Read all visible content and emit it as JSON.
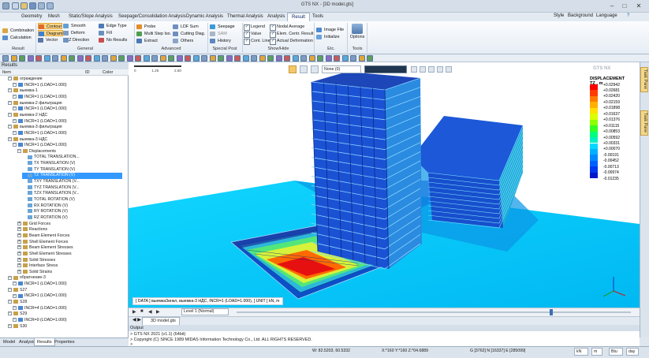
{
  "window": {
    "title": "GTS NX - [3D model.gts]",
    "controls": [
      "–",
      "□",
      "✕"
    ]
  },
  "menu": {
    "tabs": [
      "Geometry",
      "Mesh",
      "Static/Slope Analysis",
      "Seepage/Consolidation Analysis",
      "Dynamic Analysis",
      "Thermal Analysis",
      "Analysis",
      "Result",
      "Tools"
    ],
    "right": {
      "style": "Style",
      "background": "Background",
      "language": "Language"
    }
  },
  "ribbon": {
    "result": {
      "combination": "Combination",
      "calculation": "Calculation",
      "label": "Result"
    },
    "general": {
      "contour": "Contour",
      "diagram": "Diagram",
      "vector": "Vector",
      "smooth": "Smooth",
      "deform": "Deform",
      "xyz_direction": "XYZ Direction",
      "edge_type": "Edge Type",
      "fill": "Fill",
      "no_results": "No Results",
      "label": "General"
    },
    "advanced": {
      "probe": "Probe",
      "multi_step": "Multi Step Iso.",
      "extract": "Extract",
      "ldf_sum": "LDF Sum",
      "cutting_diag": "Cutting Diag.",
      "others": "Others",
      "label": "Advanced"
    },
    "special_post": {
      "seepage": "Seepage",
      "sam": "SAM",
      "history": "History",
      "label": "Special Post"
    },
    "show_hide": {
      "legend": "Legend",
      "value": "Value",
      "cont_line": "Cont. Line",
      "nodal_average": "Nodal Average",
      "elem_centr_result": "Elem. Centr. Result",
      "actual_deformation": "Actual Deformation",
      "label": "Show/Hide"
    },
    "etc": {
      "image_file": "Image File",
      "initialize": "Initialize",
      "label": "Etc."
    },
    "tools": {
      "options": "Options",
      "label": "Tools"
    }
  },
  "results_panel": {
    "title": "Results",
    "columns": {
      "item": "Item",
      "id": "ID",
      "color": "Color"
    },
    "tree": [
      {
        "label": "ограждение",
        "indent": 1,
        "icon": "folder"
      },
      {
        "label": "INCR=1 (LOAD=1.000)",
        "indent": 2,
        "icon": "step"
      },
      {
        "label": "выемка-1",
        "indent": 1,
        "icon": "folder"
      },
      {
        "label": "INCR=1 (LOAD=1.000)",
        "indent": 2,
        "icon": "step"
      },
      {
        "label": "выемка-2 фильтрация",
        "indent": 1,
        "icon": "folder"
      },
      {
        "label": "INCR=1 (LOAD=1.000)",
        "indent": 2,
        "icon": "step"
      },
      {
        "label": "выемка-2 НДС",
        "indent": 1,
        "icon": "folder"
      },
      {
        "label": "INCR=1 (LOAD=1.000)",
        "indent": 2,
        "icon": "step"
      },
      {
        "label": "выемка-3 фильтрация",
        "indent": 1,
        "icon": "folder"
      },
      {
        "label": "INCR=1 (LOAD=1.000)",
        "indent": 2,
        "icon": "step"
      },
      {
        "label": "выемка-3 НДС",
        "indent": 1,
        "icon": "folder"
      },
      {
        "label": "INCR=1 (LOAD=1.000)",
        "indent": 2,
        "icon": "step"
      },
      {
        "label": "Displacements",
        "indent": 3,
        "icon": "folder"
      },
      {
        "label": "TOTAL TRANSLATION...",
        "indent": 4,
        "icon": "result"
      },
      {
        "label": "TX TRANSLATION (V)",
        "indent": 4,
        "icon": "result"
      },
      {
        "label": "TY TRANSLATION (V)",
        "indent": 4,
        "icon": "result"
      },
      {
        "label": "TZ TRANSLATION (V)",
        "indent": 4,
        "icon": "result",
        "selected": true
      },
      {
        "label": "TXY TRANSLATION (V...",
        "indent": 4,
        "icon": "result"
      },
      {
        "label": "TYZ TRANSLATION (V...",
        "indent": 4,
        "icon": "result"
      },
      {
        "label": "TZX TRANSLATION (V...",
        "indent": 4,
        "icon": "result"
      },
      {
        "label": "TOTAL ROTATION (V)",
        "indent": 4,
        "icon": "result"
      },
      {
        "label": "RX ROTATION (V)",
        "indent": 4,
        "icon": "result"
      },
      {
        "label": "RY ROTATION (V)",
        "indent": 4,
        "icon": "result"
      },
      {
        "label": "RZ ROTATION (V)",
        "indent": 4,
        "icon": "result"
      },
      {
        "label": "Grid Forces",
        "indent": 3,
        "icon": "folder"
      },
      {
        "label": "Reactions",
        "indent": 3,
        "icon": "folder"
      },
      {
        "label": "Beam Element Forces",
        "indent": 3,
        "icon": "folder"
      },
      {
        "label": "Shell Element Forces",
        "indent": 3,
        "icon": "folder"
      },
      {
        "label": "Beam Element Stresses",
        "indent": 3,
        "icon": "folder"
      },
      {
        "label": "Shell Element Stresses",
        "indent": 3,
        "icon": "folder"
      },
      {
        "label": "Solid Stresses",
        "indent": 3,
        "icon": "folder"
      },
      {
        "label": "Interface Stress",
        "indent": 3,
        "icon": "folder"
      },
      {
        "label": "Solid Strains",
        "indent": 3,
        "icon": "folder"
      },
      {
        "label": "обратнение-3",
        "indent": 1,
        "icon": "folder"
      },
      {
        "label": "INCR=1 (LOAD=1.000)",
        "indent": 2,
        "icon": "step"
      },
      {
        "label": "S27",
        "indent": 1,
        "icon": "folder"
      },
      {
        "label": "INCR=1 (LOAD=1.000)",
        "indent": 2,
        "icon": "step"
      },
      {
        "label": "S28",
        "indent": 1,
        "icon": "folder"
      },
      {
        "label": "INCR=4 (LOAD=1.000)",
        "indent": 2,
        "icon": "step"
      },
      {
        "label": "S29",
        "indent": 1,
        "icon": "folder"
      },
      {
        "label": "INCR=9 (LOAD=1.000)",
        "indent": 2,
        "icon": "step"
      },
      {
        "label": "S30",
        "indent": 1,
        "icon": "folder"
      }
    ],
    "bottom_tabs": [
      "Model",
      "Analysis",
      "Results",
      "Properties"
    ]
  },
  "viewport": {
    "view_dropdown": "None (0)",
    "legend": {
      "title": "DISPLACEMENT",
      "subtitle": "TZ , m",
      "values": [
        "+0.02942",
        "+0.02681",
        "+0.02420",
        "+0.02159",
        "+0.01898",
        "+0.01637",
        "+0.01376",
        "+0.01115",
        "+0.00853",
        "+0.00592",
        "+0.00331",
        "+0.00070",
        "-0.00191",
        "-0.00452",
        "-0.00713",
        "-0.00974",
        "-0.01235"
      ],
      "colors": [
        "#ff0000",
        "#ff3b00",
        "#ff7a00",
        "#ffb000",
        "#ffe000",
        "#d9ff00",
        "#8cff00",
        "#35ff22",
        "#00ff7a",
        "#00f0c0",
        "#00d8ff",
        "#00b0ff",
        "#0088ff",
        "#0060ff",
        "#0038f0",
        "#0018c8"
      ]
    },
    "status": "[ DATA ] выемка3инкл, выемка-3 НДС, INCR=1 (LOAD=1.000), [ UNIT ] kN, m",
    "ruler": [
      "0",
      "1.25",
      "2.50"
    ],
    "brand": "GTS NX"
  },
  "controlbar": {
    "level": "Level 1 (Normal)"
  },
  "doc_tab": "3D model.gts",
  "output": {
    "title": "Output",
    "lines": [
      "> GTS NX 2021 (v1.1) (64bit)",
      "> Copyright (C) SINCE 1989 MIDAS Information Technology Co., Ltd. ALL RIGHTS RESERVED.",
      ">"
    ]
  },
  "right_tabs": [
    "Task Pane",
    "Task Pane"
  ],
  "statusbar": {
    "w": "W: 82.5203, 60.5332",
    "n": "X:*160  Y:*160  Z:*04.6889",
    "g": "G [3762] N [16337] E [285099]",
    "unit1": "kN",
    "unit2": "m",
    "unit3": "Btu",
    "unit4": "day"
  },
  "colors": {
    "accent": "#3399ff",
    "ribbon_selected": "#ffd98a",
    "ground": "#00c8ff"
  }
}
